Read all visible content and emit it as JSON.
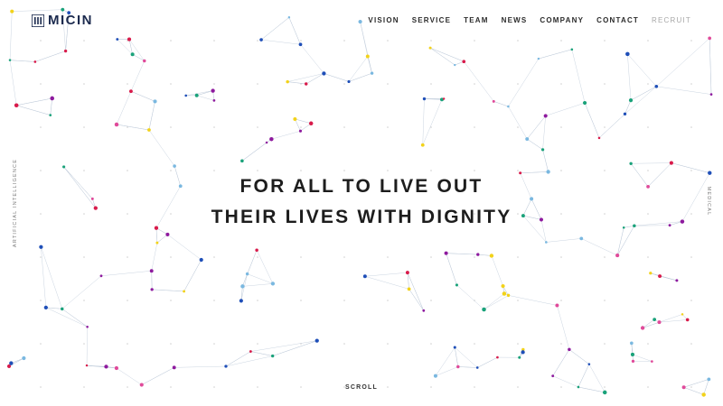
{
  "brand": {
    "name": "MICIN",
    "color": "#1b2a4e"
  },
  "nav": {
    "items": [
      {
        "label": "VISION"
      },
      {
        "label": "SERVICE"
      },
      {
        "label": "TEAM"
      },
      {
        "label": "NEWS"
      },
      {
        "label": "COMPANY"
      },
      {
        "label": "CONTACT"
      },
      {
        "label": "RECRUIT"
      }
    ]
  },
  "hero": {
    "line1": "FOR ALL TO LIVE OUT",
    "line2": "THEIR LIVES WITH DIGNITY"
  },
  "side": {
    "left": "ARTIFICIAL INTELLIGENCE",
    "right": "MEDICAL"
  },
  "scroll_label": "SCROLL",
  "palette": [
    "#8e1a9e",
    "#d81b4b",
    "#1aa27a",
    "#f2d21a",
    "#1f4fb8",
    "#7ab8e0",
    "#e04a9a"
  ]
}
